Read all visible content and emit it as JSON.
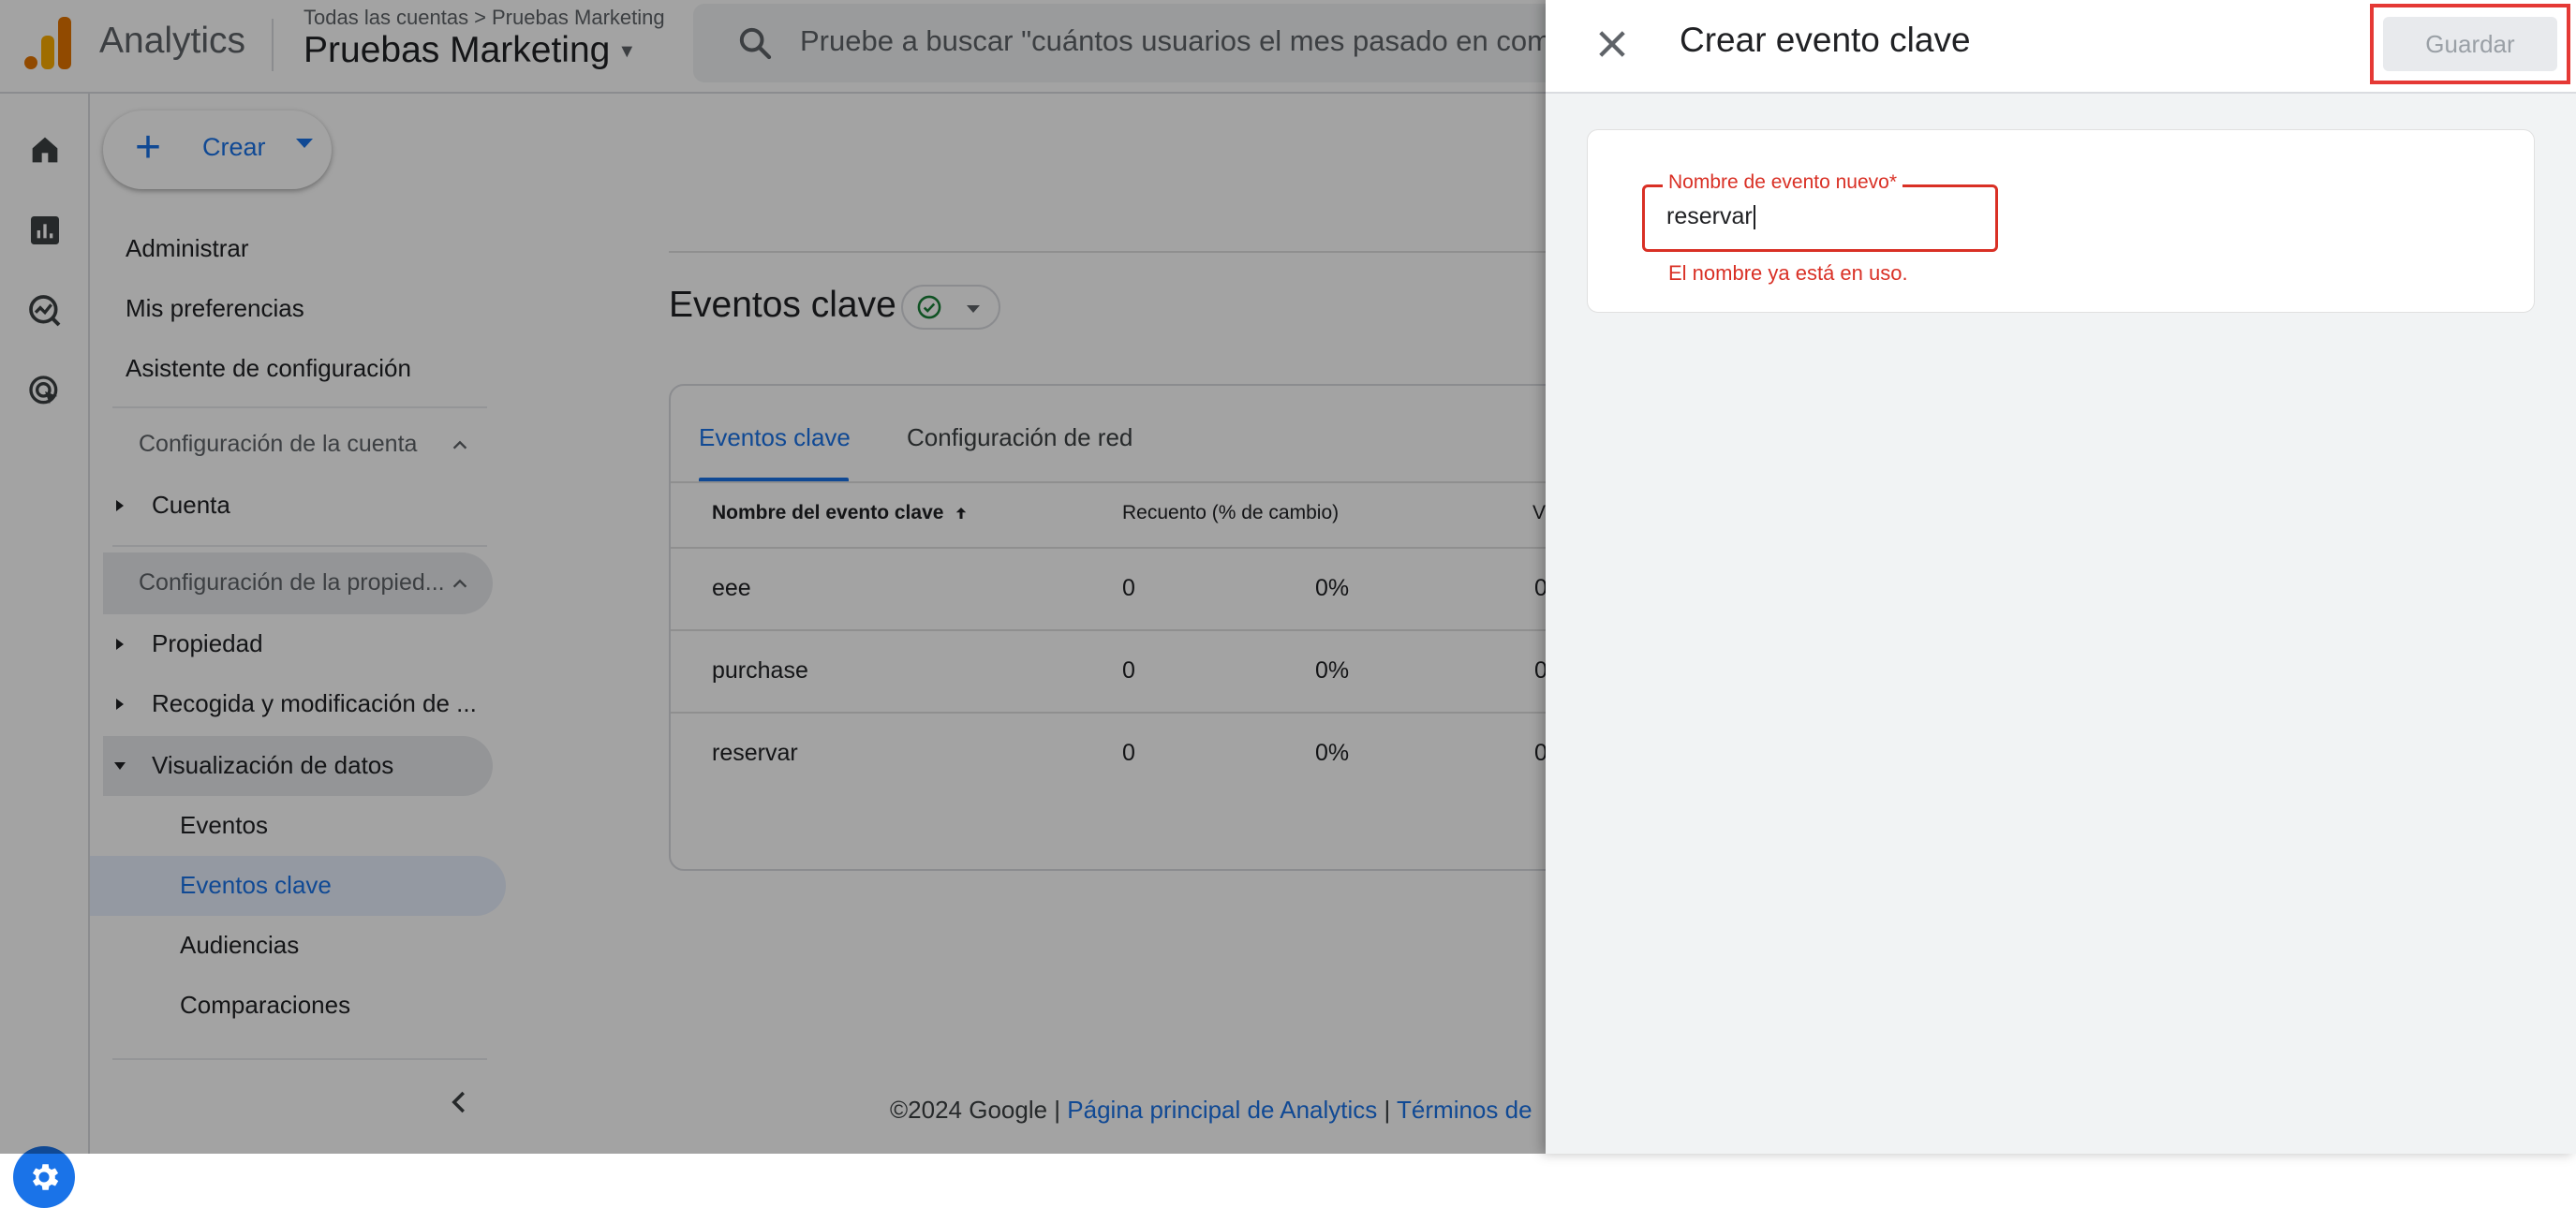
{
  "header": {
    "app_name": "Analytics",
    "breadcrumb": [
      "Todas las cuentas",
      "Pruebas Marketing"
    ],
    "breadcrumb_separator": ">",
    "property_name": "Pruebas Marketing",
    "search_placeholder": "Pruebe a buscar \"cuántos usuarios el mes pasado en comp"
  },
  "rail": {
    "icons": [
      "home-icon",
      "reports-icon",
      "explore-icon",
      "advertising-icon",
      "settings-icon"
    ],
    "settings_color": "#1a73e8"
  },
  "nav": {
    "create_label": "Crear",
    "top_items": [
      "Administrar",
      "Mis preferencias",
      "Asistente de configuración"
    ],
    "account_section": "Configuración de la cuenta",
    "account_items": [
      "Cuenta"
    ],
    "property_section": "Configuración de la propied...",
    "property_items": [
      "Propiedad",
      "Recogida y modificación de ...",
      "Visualización de datos"
    ],
    "data_display_items": [
      "Eventos",
      "Eventos clave",
      "Audiencias",
      "Comparaciones"
    ],
    "active_item": "Eventos clave"
  },
  "main": {
    "title": "Eventos clave",
    "tabs": [
      "Eventos clave",
      "Configuración de red"
    ],
    "columns": [
      "Nombre del evento clave",
      "Recuento (% de cambio)",
      "V"
    ],
    "rows": [
      {
        "name": "eee",
        "count": "0",
        "change": "0%",
        "value": "0"
      },
      {
        "name": "purchase",
        "count": "0",
        "change": "0%",
        "value": "0"
      },
      {
        "name": "reservar",
        "count": "0",
        "change": "0%",
        "value": "0"
      }
    ],
    "footer_copyright": "©2024 Google |",
    "footer_link1": "Página principal de Analytics",
    "footer_sep": "|",
    "footer_link2": "Términos de"
  },
  "panel": {
    "title": "Crear evento clave",
    "save_label": "Guardar",
    "field_label": "Nombre de evento nuevo*",
    "field_value": "reservar",
    "error_text": "El nombre ya está en uso.",
    "error_color": "#d93025",
    "highlight_color": "#e53935"
  }
}
